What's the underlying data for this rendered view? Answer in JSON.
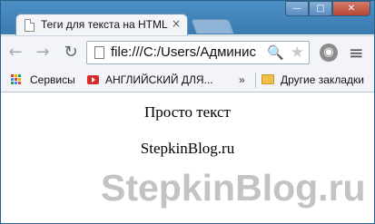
{
  "tab": {
    "title": "Теги для текста на HTML",
    "close": "×"
  },
  "window_controls": {
    "minimize": "—",
    "maximize": "□",
    "close": "✕"
  },
  "toolbar": {
    "back_icon": "←",
    "forward_icon": "→",
    "reload_icon": "↻",
    "url": "file:///C:/Users/Админис",
    "zoom_icon": "🔍",
    "star_icon": "★",
    "extension_icon": "◉",
    "menu_icon": "≡"
  },
  "bookmarks": {
    "items": [
      {
        "label": "Сервисы",
        "icon": "apps-icon"
      },
      {
        "label": "АНГЛИЙСКИЙ ДЛЯ...",
        "icon": "youtube-icon"
      },
      {
        "label": "Другие закладки",
        "icon": "folder-icon"
      }
    ],
    "overflow": "»"
  },
  "page": {
    "paragraphs": [
      "Просто текст",
      "StepkinBlog.ru"
    ],
    "watermark": "StepkinBlog.ru"
  },
  "colors": {
    "frame": "#3a7bb1",
    "toolbar": "#f2f4f7",
    "watermark": "#c3c3c3"
  }
}
